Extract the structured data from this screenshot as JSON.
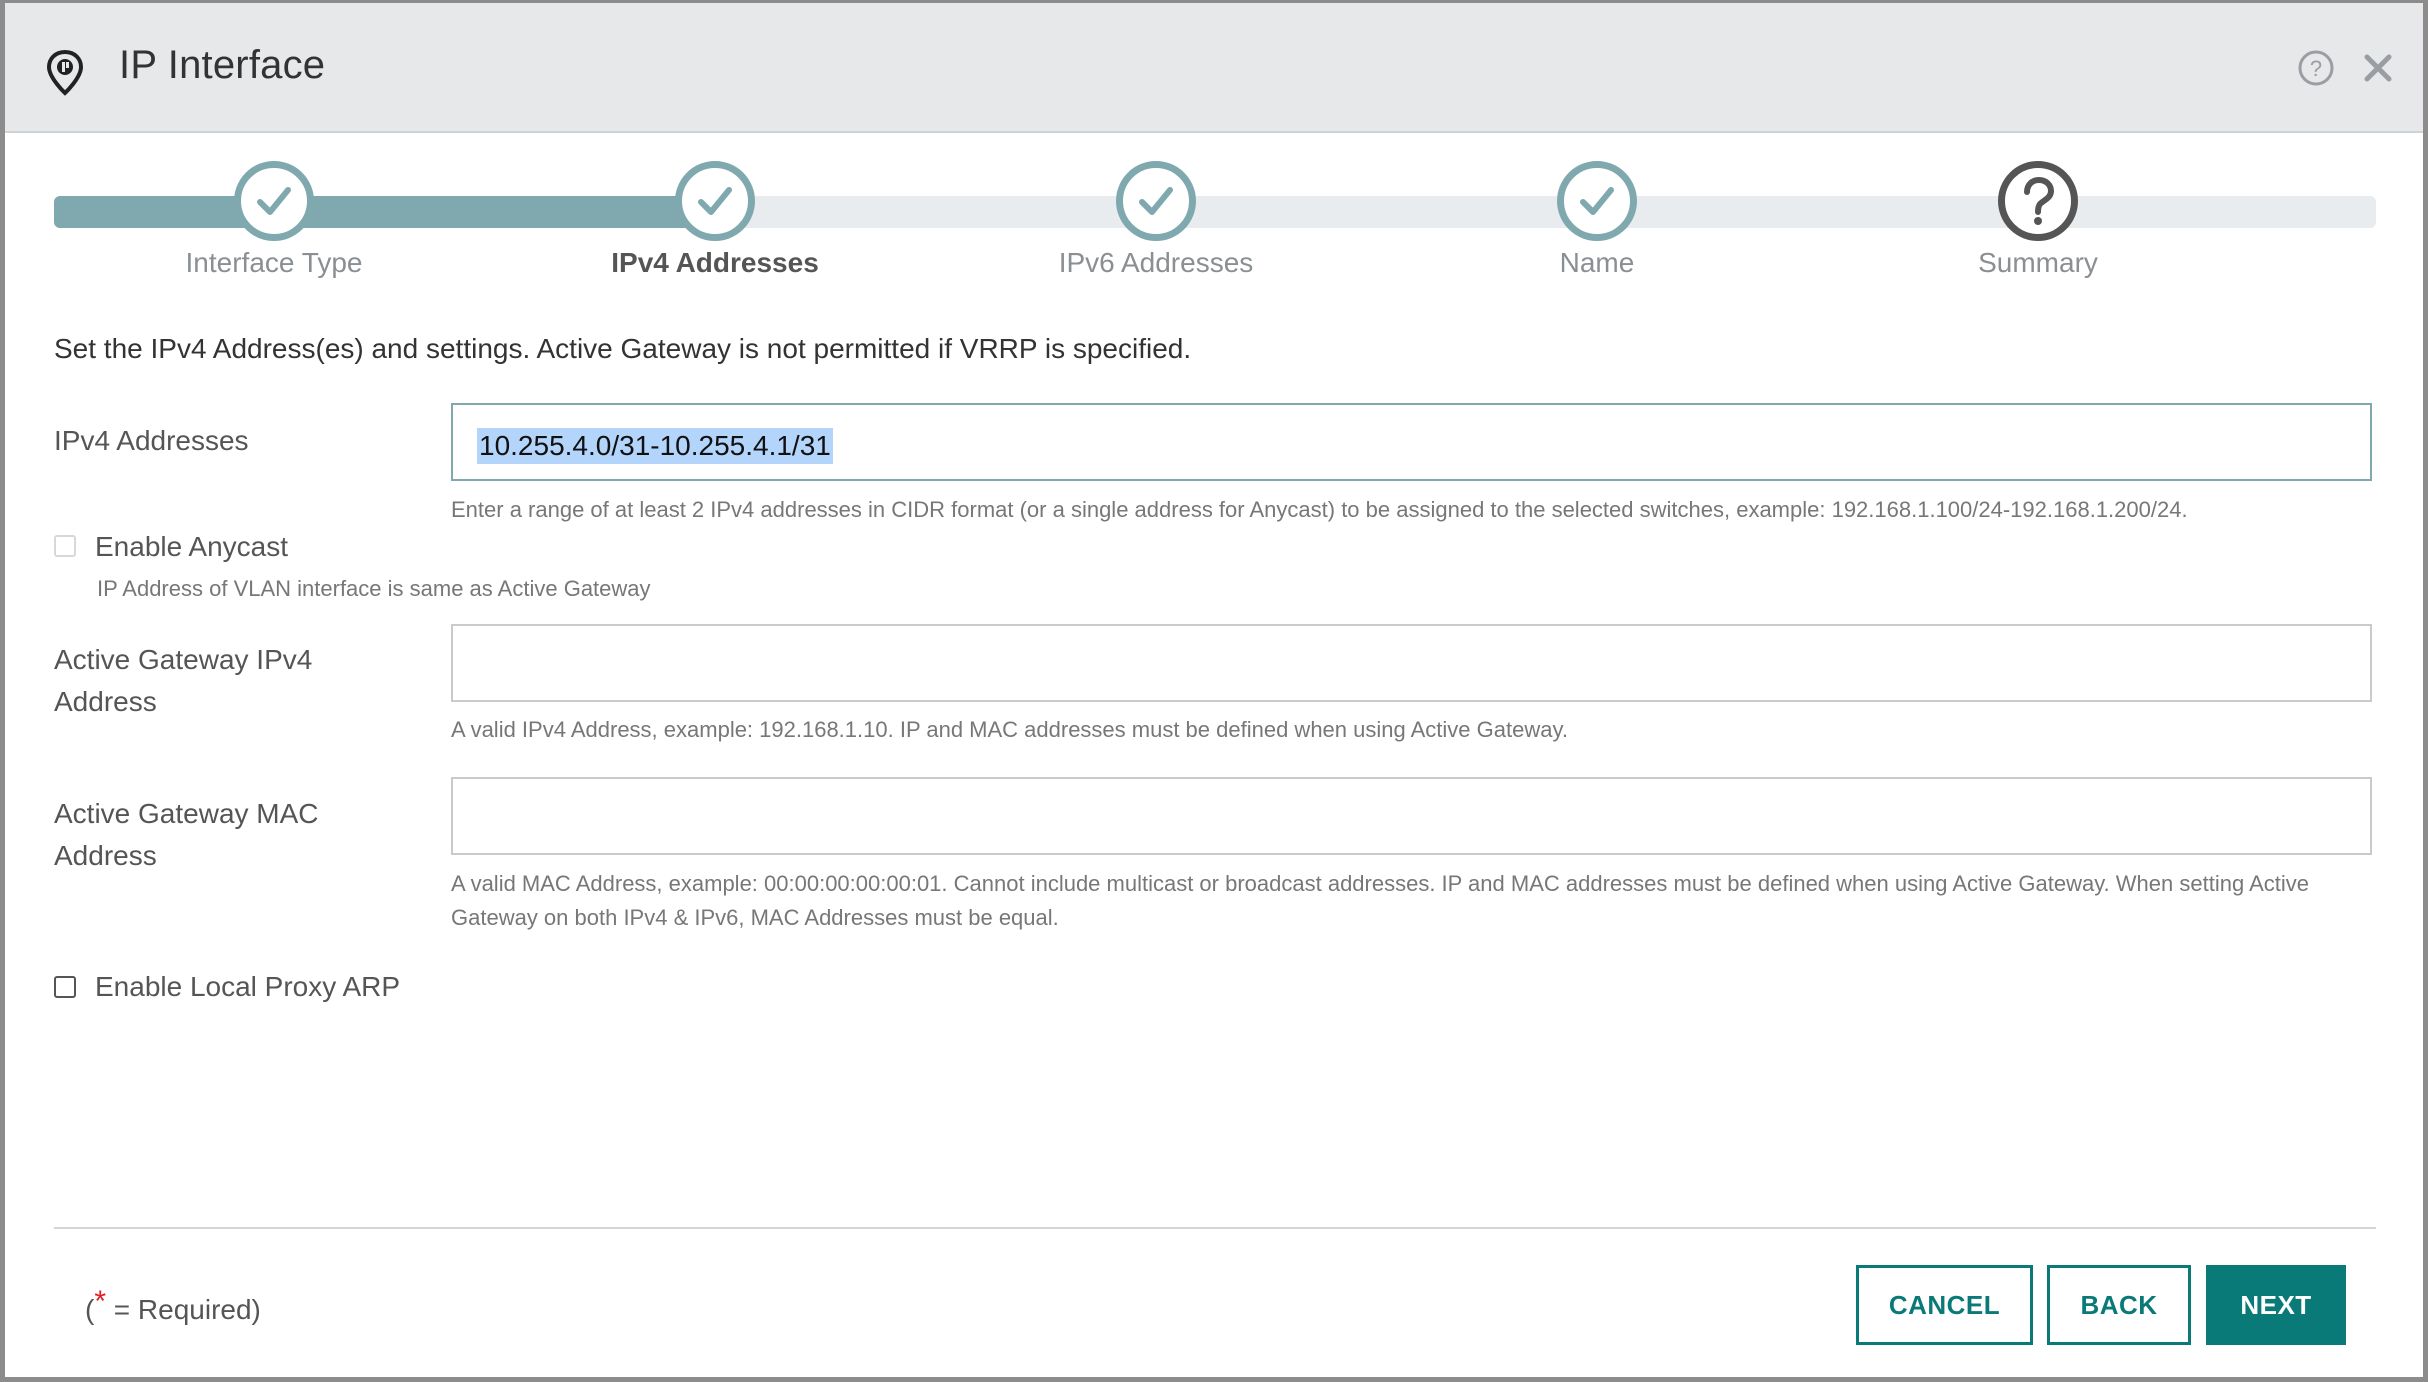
{
  "dialog": {
    "title": "IP Interface",
    "icons": {
      "header": "location-pin-icon",
      "help": "help-icon",
      "close": "close-icon"
    }
  },
  "stepper": {
    "progress_fraction": 0.285,
    "steps": [
      {
        "label": "Interface Type",
        "status": "complete",
        "icon": "check-icon"
      },
      {
        "label": "IPv4 Addresses",
        "status": "active",
        "icon": "check-icon"
      },
      {
        "label": "IPv6 Addresses",
        "status": "complete",
        "icon": "check-icon"
      },
      {
        "label": "Name",
        "status": "complete",
        "icon": "check-icon"
      },
      {
        "label": "Summary",
        "status": "incomplete",
        "icon": "question-icon"
      }
    ]
  },
  "intro": "Set the IPv4 Address(es) and settings. Active Gateway is not permitted if VRRP is specified.",
  "ipv4": {
    "label": "IPv4 Addresses",
    "value": "10.255.4.0/31-10.255.4.1/31",
    "hint": "Enter a range of at least 2 IPv4 addresses in CIDR format (or a single address for Anycast) to be assigned to the selected switches, example: 192.168.1.100/24-192.168.1.200/24."
  },
  "anycast": {
    "label": "Enable Anycast",
    "checked": false,
    "disabled": true,
    "hint": "IP Address of VLAN interface is same as Active Gateway"
  },
  "gateway_ip": {
    "label_line1": "Active Gateway IPv4",
    "label_line2": "Address",
    "value": "",
    "hint": "A valid IPv4 Address, example: 192.168.1.10. IP and MAC addresses must be defined when using Active Gateway."
  },
  "gateway_mac": {
    "label_line1": "Active Gateway MAC",
    "label_line2": "Address",
    "value": "",
    "hint_line1": "A valid MAC Address, example: 00:00:00:00:00:01. Cannot include multicast or broadcast addresses. IP and MAC addresses must be defined when using Active Gateway. When setting Active",
    "hint_line2": "Gateway on both IPv4 & IPv6, MAC Addresses must be equal."
  },
  "proxy_arp": {
    "label": "Enable Local Proxy ARP",
    "checked": false
  },
  "footer": {
    "required_open": "(",
    "required_star": "*",
    "required_text": " = Required)",
    "cancel": "CANCEL",
    "back": "BACK",
    "next": "NEXT"
  },
  "colors": {
    "accent": "#0a7a78",
    "step_complete": "#7fa9ae",
    "step_pending": "#555555",
    "selection": "#b3d4fb"
  }
}
